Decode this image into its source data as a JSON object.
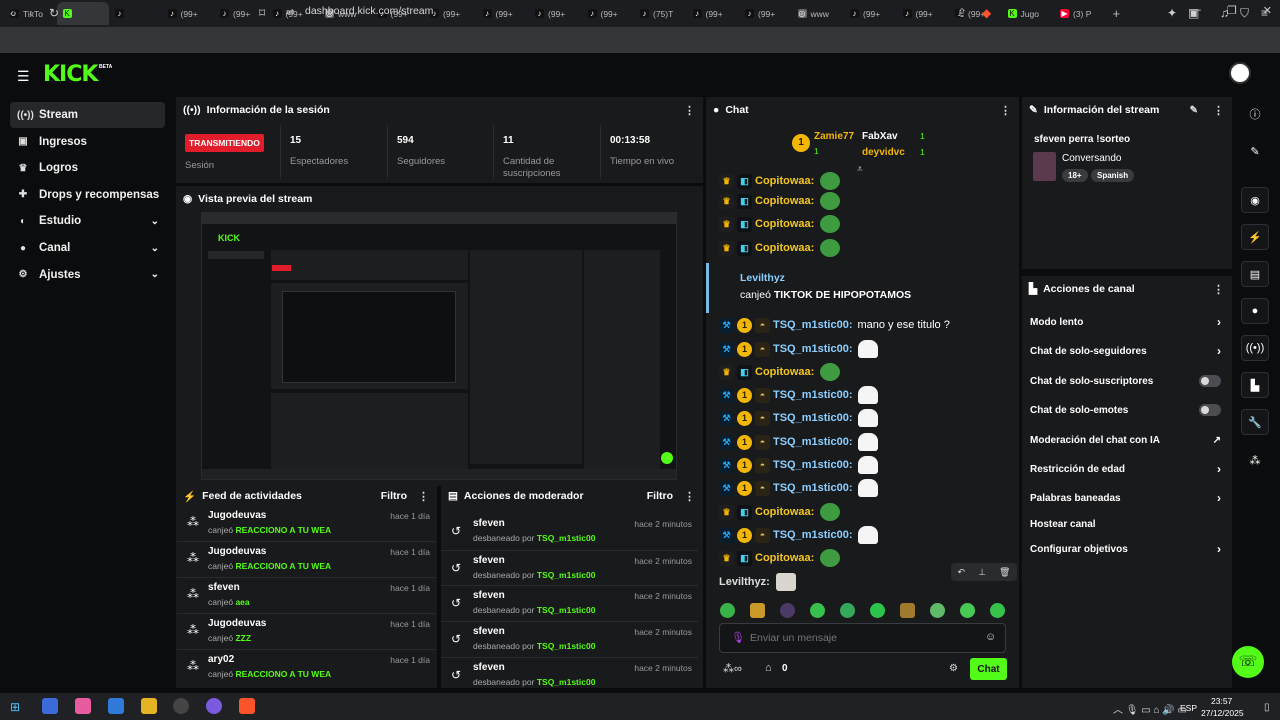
{
  "browser": {
    "tabs": [
      {
        "label": "TikTo",
        "fav": "tiktok"
      },
      {
        "label": "",
        "fav": "kick"
      },
      {
        "label": "",
        "fav": "tiktok"
      },
      {
        "label": "(99+",
        "fav": "tiktok"
      },
      {
        "label": "(99+",
        "fav": "tiktok"
      },
      {
        "label": "(99+",
        "fav": "tiktok"
      },
      {
        "label": "www",
        "fav": "globe"
      },
      {
        "label": "(99+",
        "fav": "tiktok"
      },
      {
        "label": "(99+",
        "fav": "tiktok"
      },
      {
        "label": "(99+",
        "fav": "tiktok"
      },
      {
        "label": "(99+",
        "fav": "tiktok"
      },
      {
        "label": "(99+",
        "fav": "tiktok"
      },
      {
        "label": "(75)T",
        "fav": "tiktok"
      },
      {
        "label": "(99+",
        "fav": "tiktok"
      },
      {
        "label": "(99+",
        "fav": "tiktok"
      },
      {
        "label": "www",
        "fav": "globe"
      },
      {
        "label": "(99+",
        "fav": "tiktok"
      },
      {
        "label": "(99+",
        "fav": "tiktok"
      },
      {
        "label": "(99+",
        "fav": "tiktok"
      },
      {
        "label": "Jugo",
        "fav": "kick"
      },
      {
        "label": "(3) P",
        "fav": "youtube"
      }
    ],
    "new_tab": "+",
    "url": "dashboard.kick.com/stream"
  },
  "header": {
    "logo": "KICK",
    "beta": "BETA"
  },
  "sidebar": {
    "items": [
      {
        "label": "Stream",
        "icon": "broadcast-icon"
      },
      {
        "label": "Ingresos",
        "icon": "wallet-icon"
      },
      {
        "label": "Logros",
        "icon": "trophy-icon"
      },
      {
        "label": "Drops y recompensas",
        "icon": "gift-icon"
      },
      {
        "label": "Estudio",
        "icon": "palette-icon"
      },
      {
        "label": "Canal",
        "icon": "user-icon"
      },
      {
        "label": "Ajustes",
        "icon": "gear-icon"
      }
    ]
  },
  "session": {
    "title": "Información de la sesión",
    "status": "TRANSMITIENDO",
    "status_label": "Sesión",
    "stats": [
      {
        "value": "15",
        "label": "Espectadores"
      },
      {
        "value": "594",
        "label": "Seguidores"
      },
      {
        "value": "11",
        "label": "Cantidad de suscripciones"
      },
      {
        "value": "00:13:58",
        "label": "Tiempo en vivo"
      }
    ]
  },
  "preview": {
    "title": "Vista previa del stream"
  },
  "feed": {
    "title": "Feed de actividades",
    "filter": "Filtro",
    "items": [
      {
        "name": "Jugodeuvas",
        "action": "canjeó",
        "reward": "REACCIONO A TU WEA",
        "time": "hace 1 día"
      },
      {
        "name": "Jugodeuvas",
        "action": "canjeó",
        "reward": "REACCIONO A TU WEA",
        "time": "hace 1 día"
      },
      {
        "name": "sfeven",
        "action": "canjeó",
        "reward": "aea",
        "time": "hace 1 día"
      },
      {
        "name": "Jugodeuvas",
        "action": "canjeó",
        "reward": "ZZZ",
        "time": "hace 1 día"
      },
      {
        "name": "ary02",
        "action": "canjeó",
        "reward": "REACCIONO A TU WEA",
        "time": "hace 1 día"
      }
    ]
  },
  "mod": {
    "title": "Acciones de moderador",
    "filter": "Filtro",
    "items": [
      {
        "name": "sfeven",
        "action": "desbaneado por",
        "by": "TSQ_m1stic00",
        "time": "hace 2 minutos"
      },
      {
        "name": "sfeven",
        "action": "desbaneado por",
        "by": "TSQ_m1stic00",
        "time": "hace 2 minutos"
      },
      {
        "name": "sfeven",
        "action": "desbaneado por",
        "by": "TSQ_m1stic00",
        "time": "hace 2 minutos"
      },
      {
        "name": "sfeven",
        "action": "desbaneado por",
        "by": "TSQ_m1stic00",
        "time": "hace 2 minutos"
      },
      {
        "name": "sfeven",
        "action": "desbaneado por",
        "by": "TSQ_m1stic00",
        "time": "hace 2 minutos"
      }
    ]
  },
  "chat": {
    "title": "Chat",
    "leaders": [
      {
        "name": "Zamie77",
        "count": "1"
      },
      {
        "name": "FabXav",
        "count": "1"
      },
      {
        "name": "deyvidvc",
        "count": "1"
      }
    ],
    "messages": [
      {
        "user": "Copitowaa:",
        "text": "",
        "badges": [
          "crown",
          "sub"
        ],
        "emote": "frog"
      },
      {
        "user": "Copitowaa:",
        "text": "",
        "badges": [
          "crown",
          "sub"
        ],
        "emote": "frog"
      },
      {
        "user": "Copitowaa:",
        "text": "",
        "badges": [
          "crown",
          "sub"
        ],
        "emote": "frog"
      },
      {
        "user": "Copitowaa:",
        "text": "",
        "badges": [
          "crown",
          "sub"
        ],
        "emote": "frog"
      },
      {
        "user": "TSQ_m1stic00:",
        "text": "mano y ese titulo ?",
        "badges": [
          "mod",
          "gold",
          "cap"
        ],
        "emote": ""
      },
      {
        "user": "TSQ_m1stic00:",
        "text": "",
        "badges": [
          "mod",
          "gold",
          "cap"
        ],
        "emote": "ghost"
      },
      {
        "user": "Copitowaa:",
        "text": "",
        "badges": [
          "crown",
          "sub"
        ],
        "emote": "frog"
      },
      {
        "user": "TSQ_m1stic00:",
        "text": "",
        "badges": [
          "mod",
          "gold",
          "cap"
        ],
        "emote": "ghost"
      },
      {
        "user": "TSQ_m1stic00:",
        "text": "",
        "badges": [
          "mod",
          "gold",
          "cap"
        ],
        "emote": "ghost"
      },
      {
        "user": "TSQ_m1stic00:",
        "text": "",
        "badges": [
          "mod",
          "gold",
          "cap"
        ],
        "emote": "ghost"
      },
      {
        "user": "TSQ_m1stic00:",
        "text": "",
        "badges": [
          "mod",
          "gold",
          "cap"
        ],
        "emote": "ghost"
      },
      {
        "user": "TSQ_m1stic00:",
        "text": "",
        "badges": [
          "mod",
          "gold",
          "cap"
        ],
        "emote": "ghost"
      },
      {
        "user": "Copitowaa:",
        "text": "",
        "badges": [
          "crown",
          "sub"
        ],
        "emote": "frog"
      },
      {
        "user": "TSQ_m1stic00:",
        "text": "",
        "badges": [
          "mod",
          "gold",
          "cap"
        ],
        "emote": "ghost"
      },
      {
        "user": "Copitowaa:",
        "text": "",
        "badges": [
          "crown",
          "sub"
        ],
        "emote": "frog"
      },
      {
        "user": "Levilthyz:",
        "text": "",
        "badges": [],
        "emote": "cat"
      }
    ],
    "redemption": {
      "user": "Levilthyz",
      "action": "canjeó",
      "reward": "TIKTOK DE HIPOPOTAMOS"
    },
    "input_placeholder": "Enviar un mensaje",
    "points": "0",
    "send": "Chat"
  },
  "stream_info": {
    "title": "Información del stream",
    "stream_title": "sfeven perra !sorteo",
    "category": "Conversando",
    "tags": [
      "18+",
      "Spanish"
    ]
  },
  "actions": {
    "title": "Acciones de canal",
    "items": [
      {
        "label": "Modo lento",
        "control": "chevron"
      },
      {
        "label": "Chat de solo-seguidores",
        "control": "chevron"
      },
      {
        "label": "Chat de solo-suscriptores",
        "control": "toggle"
      },
      {
        "label": "Chat de solo-emotes",
        "control": "toggle"
      },
      {
        "label": "Moderación del chat con IA",
        "control": "external"
      },
      {
        "label": "Restricción de edad",
        "control": "chevron"
      },
      {
        "label": "Palabras baneadas",
        "control": "chevron"
      },
      {
        "label": "Hostear canal",
        "control": "none"
      },
      {
        "label": "Configurar objetivos",
        "control": "chevron"
      }
    ]
  },
  "taskbar": {
    "lang": "ESP",
    "time": "23:57",
    "date": "27/12/2025"
  }
}
